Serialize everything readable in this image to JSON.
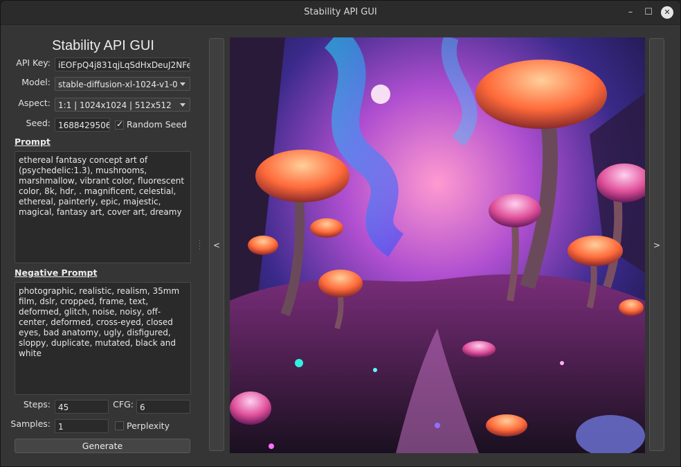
{
  "window": {
    "title": "Stability API GUI",
    "min_glyph": "–",
    "max_glyph": "☐",
    "close_glyph": "✕"
  },
  "form": {
    "heading": "Stability API GUI",
    "api_key_label": "API Key:",
    "api_key_value": "iEOFpQ4j831qjLqSdHxDeuJ2NFe",
    "model_label": "Model:",
    "model_value": "stable-diffusion-xl-1024-v1-0",
    "aspect_label": "Aspect:",
    "aspect_value": "1:1 | 1024x1024 | 512x512",
    "seed_label": "Seed:",
    "seed_value": "1688429506",
    "random_seed_label": "Random Seed",
    "random_seed_checked": true,
    "prompt_title": "Prompt",
    "prompt_text": "ethereal fantasy concept art of (psychedelic:1.3), mushrooms, marshmallow, vibrant color, fluorescent color, 8k, hdr, . magnificent, celestial, ethereal, painterly, epic, majestic, magical, fantasy art, cover art, dreamy",
    "negative_title": "Negative Prompt",
    "negative_text": "photographic, realistic, realism, 35mm film, dslr, cropped, frame, text, deformed, glitch, noise, noisy, off-center, deformed, cross-eyed, closed eyes, bad anatomy, ugly, disfigured, sloppy, duplicate, mutated, black and white",
    "steps_label": "Steps:",
    "steps_value": "45",
    "cfg_label": "CFG:",
    "cfg_value": "6",
    "samples_label": "Samples:",
    "samples_value": "1",
    "perplexity_label": "Perplexity",
    "perplexity_checked": false,
    "generate_label": "Generate"
  },
  "viewer": {
    "prev_label": "<",
    "next_label": ">"
  },
  "icons": {
    "dropdown": "chevron-down-icon",
    "check": "checkmark-icon",
    "splitter": "drag-handle-icon"
  }
}
